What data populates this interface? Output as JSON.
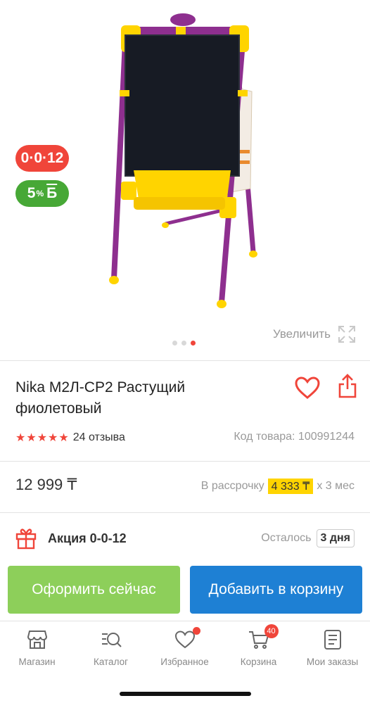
{
  "gallery": {
    "installment_badge": "0·0·12",
    "bonus_badge_value": "5",
    "bonus_badge_percent": "%",
    "bonus_badge_currency": "Б",
    "zoom_label": "Увеличить",
    "dots_count": 3,
    "active_dot": 3
  },
  "product": {
    "title": "Nika М2Л-СР2 Растущий фиолетовый",
    "rating_stars": 5,
    "reviews_label": "24 отзыва",
    "sku_label": "Код товара: 100991244"
  },
  "price": {
    "value": "12 999 ₸",
    "installment_prefix": "В рассрочку",
    "installment_amount": "4 333 ₸",
    "installment_suffix": "х 3 мес"
  },
  "promo": {
    "title": "Акция 0-0-12",
    "remaining_label": "Осталось",
    "remaining_days": "3 дня"
  },
  "actions": {
    "buy_now": "Оформить сейчас",
    "add_to_cart": "Добавить в корзину"
  },
  "nav": {
    "items": [
      {
        "label": "Магазин",
        "icon": "store-icon"
      },
      {
        "label": "Каталог",
        "icon": "catalog-search-icon"
      },
      {
        "label": "Избранное",
        "icon": "heart-icon"
      },
      {
        "label": "Корзина",
        "icon": "cart-icon",
        "count": "40"
      },
      {
        "label": "Мои заказы",
        "icon": "orders-icon"
      }
    ]
  },
  "colors": {
    "accent_red": "#f0453a",
    "bonus_green": "#47a836",
    "buy_green": "#8dcf5a",
    "cart_blue": "#1e80d4",
    "highlight_yellow": "#ffd400"
  }
}
